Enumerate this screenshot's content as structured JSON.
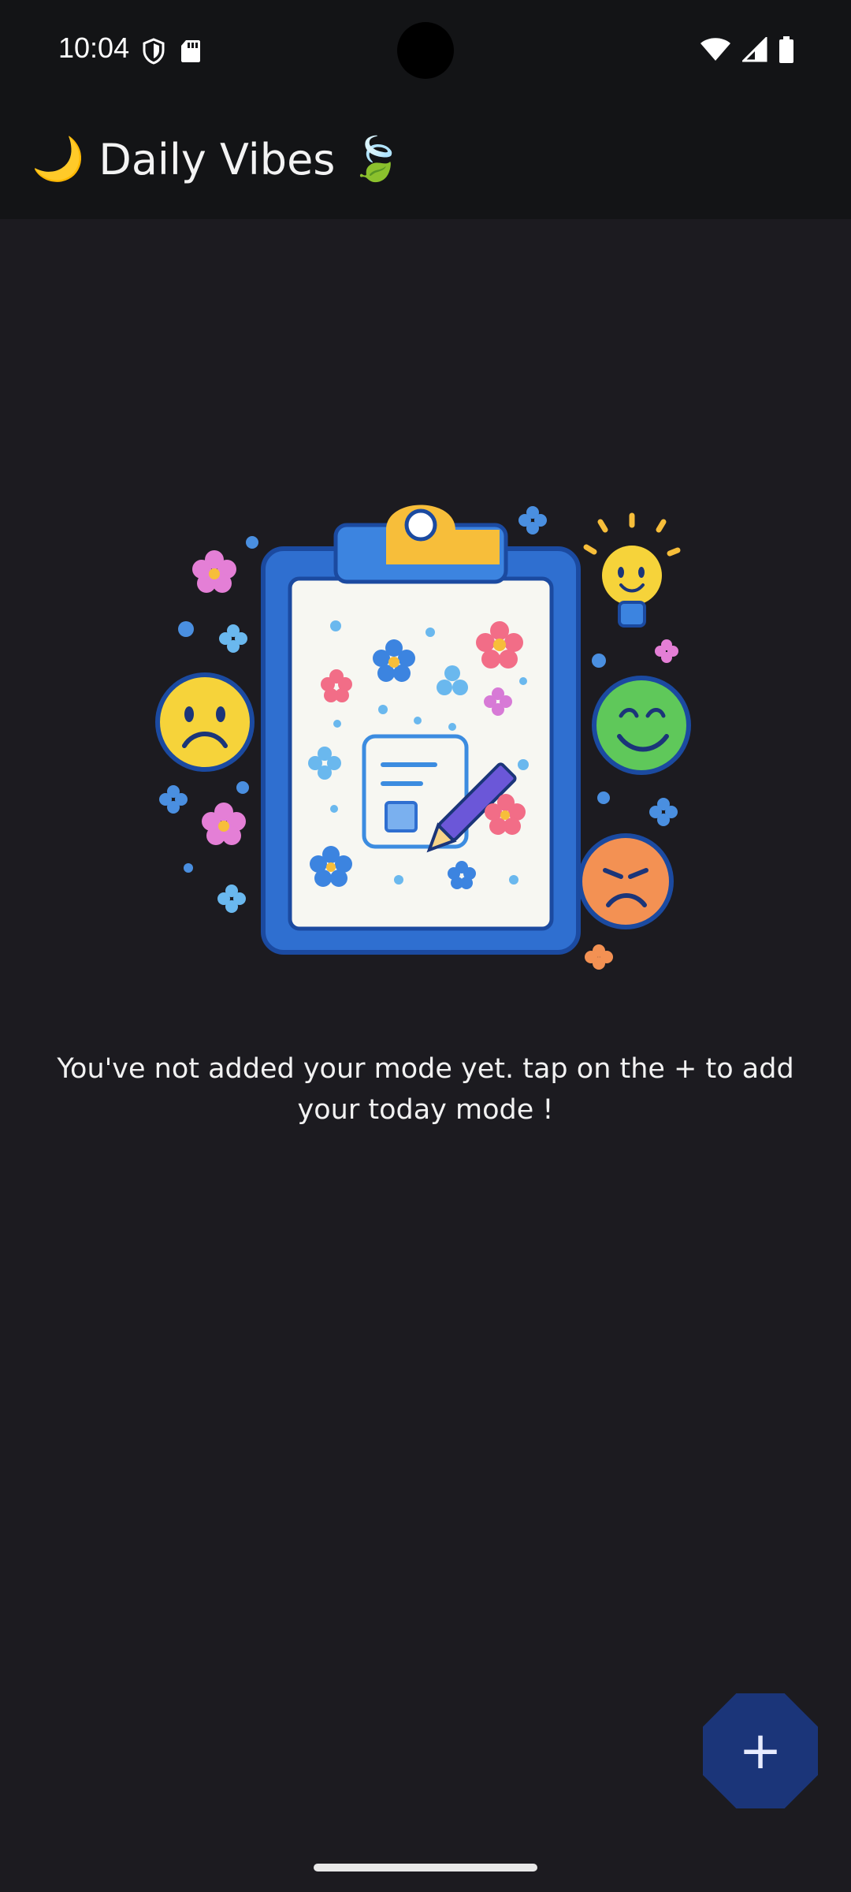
{
  "status_bar": {
    "time": "10:04",
    "icons": [
      "shield-icon",
      "sd-card-icon",
      "wifi-icon",
      "signal-icon",
      "battery-icon"
    ]
  },
  "app_bar": {
    "title": "Daily Vibes",
    "leading_emoji": "🌙",
    "trailing_emoji": "🍃"
  },
  "empty_state": {
    "message": "You've not added your mode yet. tap on the + to add your today mode !"
  },
  "fab": {
    "label": "+"
  },
  "colors": {
    "background": "#1c1b20",
    "app_bar": "#131416",
    "fab": "#1b3579",
    "clipboard": "#2f6fd0",
    "clip": "#f7be3a"
  }
}
